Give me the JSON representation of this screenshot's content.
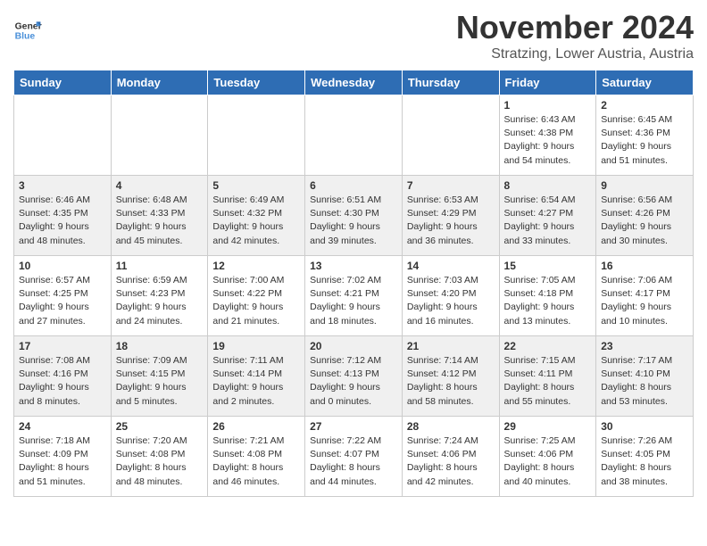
{
  "header": {
    "logo_text_general": "General",
    "logo_text_blue": "Blue",
    "month_title": "November 2024",
    "location": "Stratzing, Lower Austria, Austria"
  },
  "weekdays": [
    "Sunday",
    "Monday",
    "Tuesday",
    "Wednesday",
    "Thursday",
    "Friday",
    "Saturday"
  ],
  "weeks": [
    [
      {
        "day": "",
        "sunrise": "",
        "sunset": "",
        "daylight": ""
      },
      {
        "day": "",
        "sunrise": "",
        "sunset": "",
        "daylight": ""
      },
      {
        "day": "",
        "sunrise": "",
        "sunset": "",
        "daylight": ""
      },
      {
        "day": "",
        "sunrise": "",
        "sunset": "",
        "daylight": ""
      },
      {
        "day": "",
        "sunrise": "",
        "sunset": "",
        "daylight": ""
      },
      {
        "day": "1",
        "sunrise": "Sunrise: 6:43 AM",
        "sunset": "Sunset: 4:38 PM",
        "daylight": "Daylight: 9 hours and 54 minutes."
      },
      {
        "day": "2",
        "sunrise": "Sunrise: 6:45 AM",
        "sunset": "Sunset: 4:36 PM",
        "daylight": "Daylight: 9 hours and 51 minutes."
      }
    ],
    [
      {
        "day": "3",
        "sunrise": "Sunrise: 6:46 AM",
        "sunset": "Sunset: 4:35 PM",
        "daylight": "Daylight: 9 hours and 48 minutes."
      },
      {
        "day": "4",
        "sunrise": "Sunrise: 6:48 AM",
        "sunset": "Sunset: 4:33 PM",
        "daylight": "Daylight: 9 hours and 45 minutes."
      },
      {
        "day": "5",
        "sunrise": "Sunrise: 6:49 AM",
        "sunset": "Sunset: 4:32 PM",
        "daylight": "Daylight: 9 hours and 42 minutes."
      },
      {
        "day": "6",
        "sunrise": "Sunrise: 6:51 AM",
        "sunset": "Sunset: 4:30 PM",
        "daylight": "Daylight: 9 hours and 39 minutes."
      },
      {
        "day": "7",
        "sunrise": "Sunrise: 6:53 AM",
        "sunset": "Sunset: 4:29 PM",
        "daylight": "Daylight: 9 hours and 36 minutes."
      },
      {
        "day": "8",
        "sunrise": "Sunrise: 6:54 AM",
        "sunset": "Sunset: 4:27 PM",
        "daylight": "Daylight: 9 hours and 33 minutes."
      },
      {
        "day": "9",
        "sunrise": "Sunrise: 6:56 AM",
        "sunset": "Sunset: 4:26 PM",
        "daylight": "Daylight: 9 hours and 30 minutes."
      }
    ],
    [
      {
        "day": "10",
        "sunrise": "Sunrise: 6:57 AM",
        "sunset": "Sunset: 4:25 PM",
        "daylight": "Daylight: 9 hours and 27 minutes."
      },
      {
        "day": "11",
        "sunrise": "Sunrise: 6:59 AM",
        "sunset": "Sunset: 4:23 PM",
        "daylight": "Daylight: 9 hours and 24 minutes."
      },
      {
        "day": "12",
        "sunrise": "Sunrise: 7:00 AM",
        "sunset": "Sunset: 4:22 PM",
        "daylight": "Daylight: 9 hours and 21 minutes."
      },
      {
        "day": "13",
        "sunrise": "Sunrise: 7:02 AM",
        "sunset": "Sunset: 4:21 PM",
        "daylight": "Daylight: 9 hours and 18 minutes."
      },
      {
        "day": "14",
        "sunrise": "Sunrise: 7:03 AM",
        "sunset": "Sunset: 4:20 PM",
        "daylight": "Daylight: 9 hours and 16 minutes."
      },
      {
        "day": "15",
        "sunrise": "Sunrise: 7:05 AM",
        "sunset": "Sunset: 4:18 PM",
        "daylight": "Daylight: 9 hours and 13 minutes."
      },
      {
        "day": "16",
        "sunrise": "Sunrise: 7:06 AM",
        "sunset": "Sunset: 4:17 PM",
        "daylight": "Daylight: 9 hours and 10 minutes."
      }
    ],
    [
      {
        "day": "17",
        "sunrise": "Sunrise: 7:08 AM",
        "sunset": "Sunset: 4:16 PM",
        "daylight": "Daylight: 9 hours and 8 minutes."
      },
      {
        "day": "18",
        "sunrise": "Sunrise: 7:09 AM",
        "sunset": "Sunset: 4:15 PM",
        "daylight": "Daylight: 9 hours and 5 minutes."
      },
      {
        "day": "19",
        "sunrise": "Sunrise: 7:11 AM",
        "sunset": "Sunset: 4:14 PM",
        "daylight": "Daylight: 9 hours and 2 minutes."
      },
      {
        "day": "20",
        "sunrise": "Sunrise: 7:12 AM",
        "sunset": "Sunset: 4:13 PM",
        "daylight": "Daylight: 9 hours and 0 minutes."
      },
      {
        "day": "21",
        "sunrise": "Sunrise: 7:14 AM",
        "sunset": "Sunset: 4:12 PM",
        "daylight": "Daylight: 8 hours and 58 minutes."
      },
      {
        "day": "22",
        "sunrise": "Sunrise: 7:15 AM",
        "sunset": "Sunset: 4:11 PM",
        "daylight": "Daylight: 8 hours and 55 minutes."
      },
      {
        "day": "23",
        "sunrise": "Sunrise: 7:17 AM",
        "sunset": "Sunset: 4:10 PM",
        "daylight": "Daylight: 8 hours and 53 minutes."
      }
    ],
    [
      {
        "day": "24",
        "sunrise": "Sunrise: 7:18 AM",
        "sunset": "Sunset: 4:09 PM",
        "daylight": "Daylight: 8 hours and 51 minutes."
      },
      {
        "day": "25",
        "sunrise": "Sunrise: 7:20 AM",
        "sunset": "Sunset: 4:08 PM",
        "daylight": "Daylight: 8 hours and 48 minutes."
      },
      {
        "day": "26",
        "sunrise": "Sunrise: 7:21 AM",
        "sunset": "Sunset: 4:08 PM",
        "daylight": "Daylight: 8 hours and 46 minutes."
      },
      {
        "day": "27",
        "sunrise": "Sunrise: 7:22 AM",
        "sunset": "Sunset: 4:07 PM",
        "daylight": "Daylight: 8 hours and 44 minutes."
      },
      {
        "day": "28",
        "sunrise": "Sunrise: 7:24 AM",
        "sunset": "Sunset: 4:06 PM",
        "daylight": "Daylight: 8 hours and 42 minutes."
      },
      {
        "day": "29",
        "sunrise": "Sunrise: 7:25 AM",
        "sunset": "Sunset: 4:06 PM",
        "daylight": "Daylight: 8 hours and 40 minutes."
      },
      {
        "day": "30",
        "sunrise": "Sunrise: 7:26 AM",
        "sunset": "Sunset: 4:05 PM",
        "daylight": "Daylight: 8 hours and 38 minutes."
      }
    ]
  ]
}
